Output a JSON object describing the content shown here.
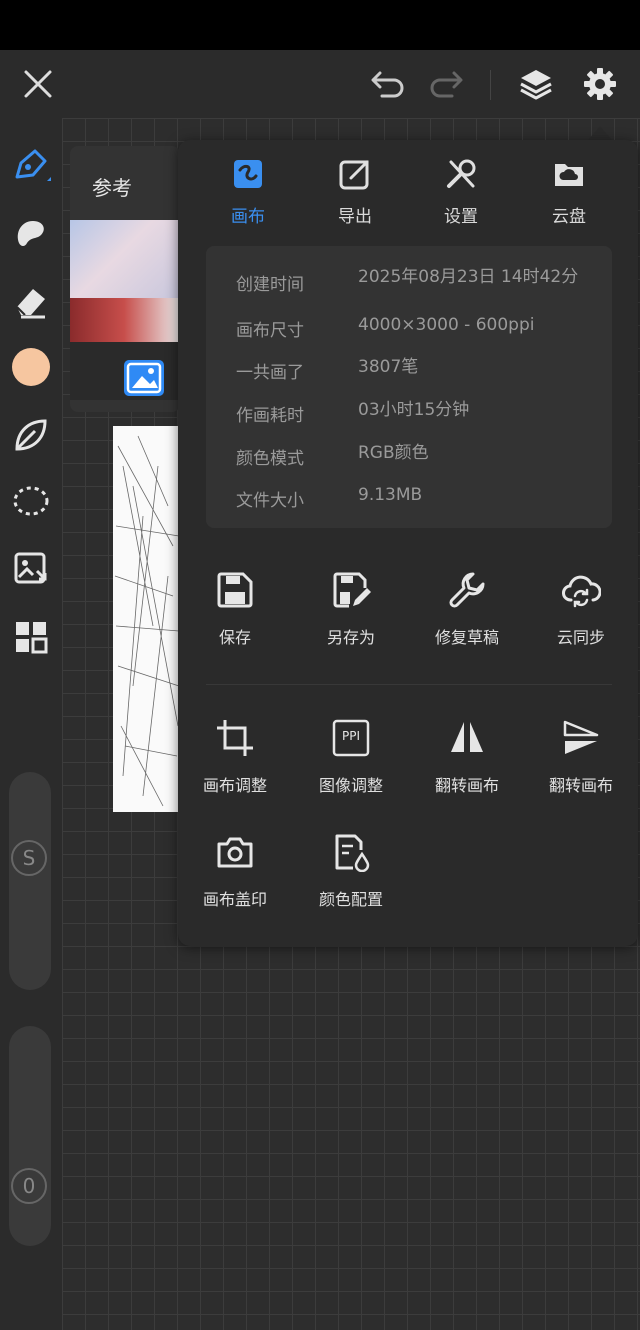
{
  "colors": {
    "accent": "#3a8ff0",
    "brush_color": "#f6c6a0"
  },
  "topbar": {
    "icons": [
      "close-icon",
      "undo-icon",
      "redo-icon",
      "layers-icon",
      "gear-icon"
    ]
  },
  "toolbar": {
    "tools": [
      "pen-icon",
      "smudge-icon",
      "eraser-icon",
      "color-swatch",
      "leaf-icon",
      "lasso-icon",
      "image-adjust-icon",
      "grid-icon"
    ]
  },
  "sliders": {
    "size_label": "S",
    "opacity_label": "0"
  },
  "reference": {
    "title": "参考"
  },
  "menu": {
    "tabs": [
      {
        "label": "画布",
        "icon": "canvas-icon"
      },
      {
        "label": "导出",
        "icon": "export-icon"
      },
      {
        "label": "设置",
        "icon": "settings-tools-icon"
      },
      {
        "label": "云盘",
        "icon": "cloud-drive-icon"
      }
    ],
    "info": [
      {
        "label": "创建时间",
        "value": "2025年08月23日 14时42分"
      },
      {
        "label": "画布尺寸",
        "value": "4000×3000 - 600ppi"
      },
      {
        "label": "一共画了",
        "value": "3807笔"
      },
      {
        "label": "作画耗时",
        "value": "03小时15分钟"
      },
      {
        "label": "颜色模式",
        "value": "RGB颜色"
      },
      {
        "label": "文件大小",
        "value": "9.13MB"
      }
    ],
    "actions_row1": [
      "保存",
      "另存为",
      "修复草稿",
      "云同步"
    ],
    "actions_row2": [
      "画布调整",
      "图像调整",
      "翻转画布",
      "翻转画布"
    ],
    "actions_row3": [
      "画布盖印",
      "颜色配置"
    ],
    "ppi_text": "PPI"
  }
}
